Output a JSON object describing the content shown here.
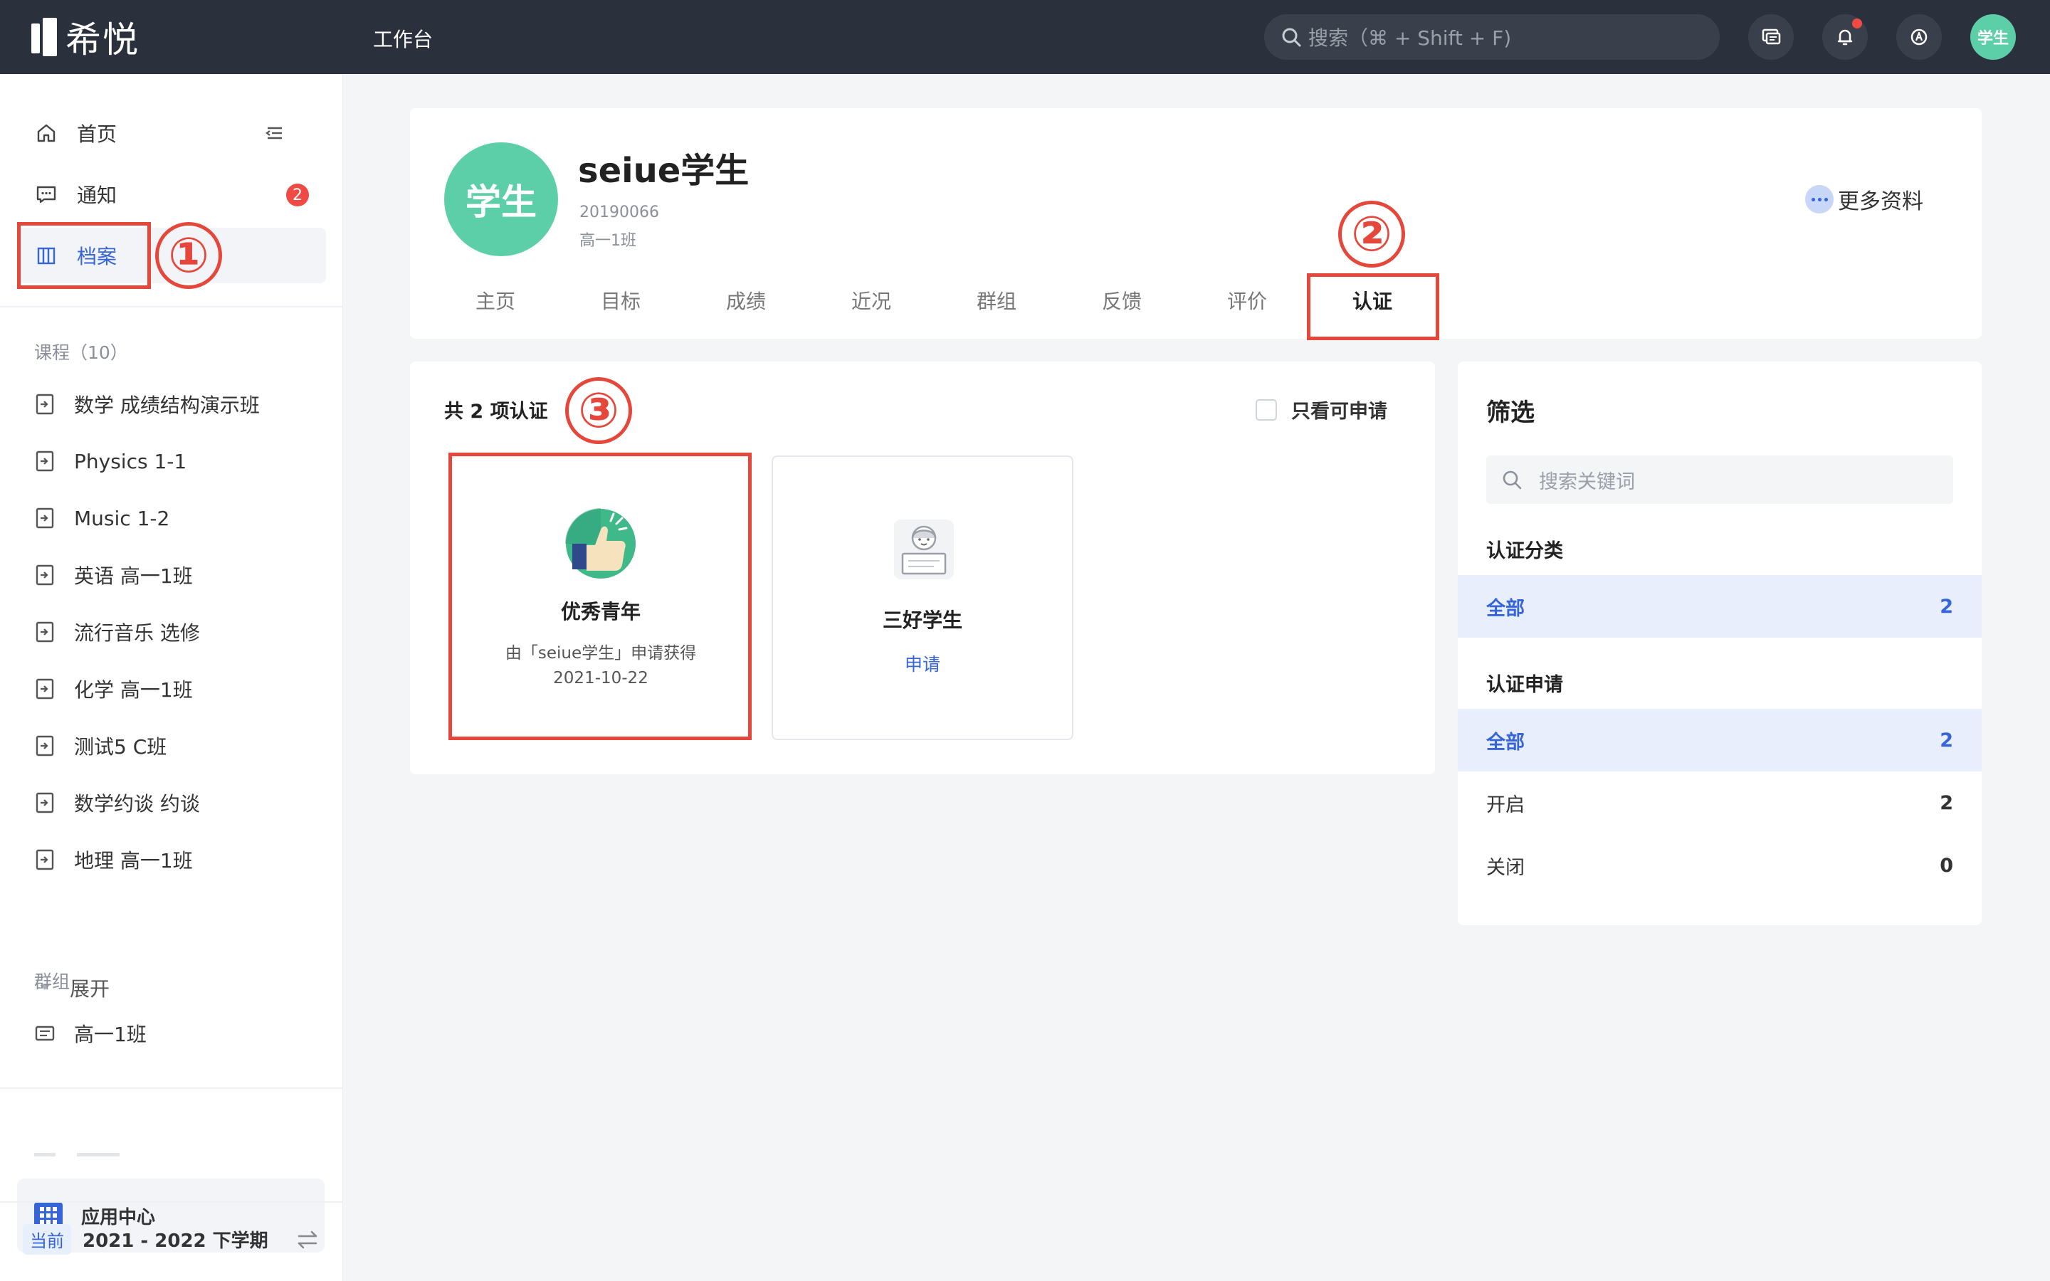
{
  "topbar": {
    "logo_text": "希悦",
    "workspace": "工作台",
    "search_placeholder": "搜索（⌘ + Shift + F)",
    "avatar_text": "学生"
  },
  "sidebar": {
    "nav": [
      {
        "label": "首页"
      },
      {
        "label": "通知",
        "badge": "2"
      },
      {
        "label": "档案"
      }
    ],
    "courses_title": "课程（10）",
    "courses": [
      "数学 成绩结构演示班",
      "Physics 1-1",
      "Music 1-2",
      "英语 高一1班",
      "流行音乐 选修",
      "化学 高一1班",
      "测试5 C班",
      "数学约谈 约谈",
      "地理 高一1班"
    ],
    "expand_label": "展开",
    "groups_title": "群组",
    "groups": [
      "高一1班"
    ],
    "app_center": "应用中心",
    "term_tag": "当前",
    "term_label": "2021 - 2022 下学期"
  },
  "profile": {
    "avatar_text": "学生",
    "name": "seiue学生",
    "student_id": "20190066",
    "class_name": "高一1班",
    "more_label": "更多资料",
    "tabs": [
      "主页",
      "目标",
      "成绩",
      "近况",
      "群组",
      "反馈",
      "评价",
      "认证"
    ],
    "active_tab": "认证"
  },
  "certifications": {
    "count_label": "共 2 项认证",
    "only_apply_label": "只看可申请",
    "items": [
      {
        "title": "优秀青年",
        "subtitle": "由「seiue学生」申请获得",
        "date": "2021-10-22",
        "icon": "thumbs-up-icon"
      },
      {
        "title": "三好学生",
        "action": "申请",
        "icon": "student-certificate-icon"
      }
    ]
  },
  "filter": {
    "title": "筛选",
    "search_placeholder": "搜索关键词",
    "category_title": "认证分类",
    "category_rows": [
      {
        "label": "全部",
        "count": "2"
      }
    ],
    "apply_title": "认证申请",
    "apply_rows": [
      {
        "label": "全部",
        "count": "2"
      },
      {
        "label": "开启",
        "count": "2"
      },
      {
        "label": "关闭",
        "count": "0"
      }
    ]
  },
  "annotations": [
    "①",
    "②",
    "③"
  ],
  "colors": {
    "topbar_bg": "#2b313c",
    "accent": "#3565d8",
    "avatar_green": "#5ccfa8",
    "annotation_red": "#e5473a",
    "badge_red": "#f04a45"
  }
}
